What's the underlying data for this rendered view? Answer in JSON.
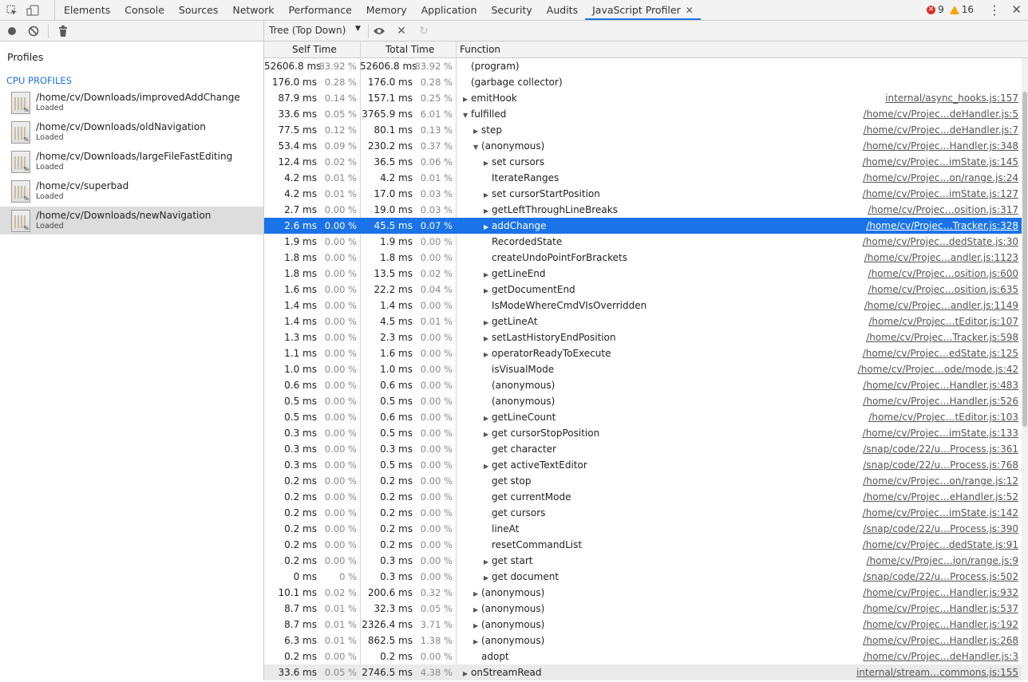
{
  "tabs": [
    {
      "label": "Elements"
    },
    {
      "label": "Console"
    },
    {
      "label": "Sources"
    },
    {
      "label": "Network"
    },
    {
      "label": "Performance"
    },
    {
      "label": "Memory"
    },
    {
      "label": "Application"
    },
    {
      "label": "Security"
    },
    {
      "label": "Audits"
    },
    {
      "label": "JavaScript Profiler",
      "active": true
    }
  ],
  "status": {
    "errors": "9",
    "warnings": "16"
  },
  "sidebar": {
    "title": "Profiles",
    "section": "CPU PROFILES",
    "profiles": [
      {
        "name": "/home/cv/Downloads/improvedAddChange",
        "status": "Loaded"
      },
      {
        "name": "/home/cv/Downloads/oldNavigation",
        "status": "Loaded"
      },
      {
        "name": "/home/cv/Downloads/largeFileFastEditing",
        "status": "Loaded"
      },
      {
        "name": "/home/cv/superbad",
        "status": "Loaded"
      },
      {
        "name": "/home/cv/Downloads/newNavigation",
        "status": "Loaded",
        "selected": true
      }
    ]
  },
  "toolbar": {
    "view": "Tree (Top Down)"
  },
  "columns": {
    "self": "Self Time",
    "total": "Total Time",
    "function": "Function"
  },
  "rows": [
    {
      "self_ms": "52606.8 ms",
      "self_pct": "83.92 %",
      "total_ms": "52606.8 ms",
      "total_pct": "83.92 %",
      "depth": 0,
      "arrow": "",
      "fn": "(program)",
      "src": ""
    },
    {
      "self_ms": "176.0 ms",
      "self_pct": "0.28 %",
      "total_ms": "176.0 ms",
      "total_pct": "0.28 %",
      "depth": 0,
      "arrow": "",
      "fn": "(garbage collector)",
      "src": ""
    },
    {
      "self_ms": "87.9 ms",
      "self_pct": "0.14 %",
      "total_ms": "157.1 ms",
      "total_pct": "0.25 %",
      "depth": 0,
      "arrow": "▶",
      "fn": "emitHook",
      "src": "internal/async_hooks.js:157"
    },
    {
      "self_ms": "33.6 ms",
      "self_pct": "0.05 %",
      "total_ms": "3765.9 ms",
      "total_pct": "6.01 %",
      "depth": 0,
      "arrow": "▼",
      "fn": "fulfilled",
      "src": "/home/cv/Projec…deHandler.js:5"
    },
    {
      "self_ms": "77.5 ms",
      "self_pct": "0.12 %",
      "total_ms": "80.1 ms",
      "total_pct": "0.13 %",
      "depth": 1,
      "arrow": "▶",
      "fn": "step",
      "src": "/home/cv/Projec…deHandler.js:7"
    },
    {
      "self_ms": "53.4 ms",
      "self_pct": "0.09 %",
      "total_ms": "230.2 ms",
      "total_pct": "0.37 %",
      "depth": 1,
      "arrow": "▼",
      "fn": "(anonymous)",
      "src": "/home/cv/Projec…Handler.js:348"
    },
    {
      "self_ms": "12.4 ms",
      "self_pct": "0.02 %",
      "total_ms": "36.5 ms",
      "total_pct": "0.06 %",
      "depth": 2,
      "arrow": "▶",
      "fn": "set cursors",
      "src": "/home/cv/Projec…imState.js:145"
    },
    {
      "self_ms": "4.2 ms",
      "self_pct": "0.01 %",
      "total_ms": "4.2 ms",
      "total_pct": "0.01 %",
      "depth": 2,
      "arrow": "",
      "fn": "IterateRanges",
      "src": "/home/cv/Projec…on/range.js:24"
    },
    {
      "self_ms": "4.2 ms",
      "self_pct": "0.01 %",
      "total_ms": "17.0 ms",
      "total_pct": "0.03 %",
      "depth": 2,
      "arrow": "▶",
      "fn": "set cursorStartPosition",
      "src": "/home/cv/Projec…imState.js:127"
    },
    {
      "self_ms": "2.7 ms",
      "self_pct": "0.00 %",
      "total_ms": "19.0 ms",
      "total_pct": "0.03 %",
      "depth": 2,
      "arrow": "▶",
      "fn": "getLeftThroughLineBreaks",
      "src": "/home/cv/Projec…osition.js:317"
    },
    {
      "self_ms": "2.6 ms",
      "self_pct": "0.00 %",
      "total_ms": "45.5 ms",
      "total_pct": "0.07 %",
      "depth": 2,
      "arrow": "▶",
      "fn": "addChange",
      "src": "/home/cv/Projec…Tracker.js:328",
      "selected": true
    },
    {
      "self_ms": "1.9 ms",
      "self_pct": "0.00 %",
      "total_ms": "1.9 ms",
      "total_pct": "0.00 %",
      "depth": 2,
      "arrow": "",
      "fn": "RecordedState",
      "src": "/home/cv/Projec…dedState.js:30"
    },
    {
      "self_ms": "1.8 ms",
      "self_pct": "0.00 %",
      "total_ms": "1.8 ms",
      "total_pct": "0.00 %",
      "depth": 2,
      "arrow": "",
      "fn": "createUndoPointForBrackets",
      "src": "/home/cv/Projec…andler.js:1123"
    },
    {
      "self_ms": "1.8 ms",
      "self_pct": "0.00 %",
      "total_ms": "13.5 ms",
      "total_pct": "0.02 %",
      "depth": 2,
      "arrow": "▶",
      "fn": "getLineEnd",
      "src": "/home/cv/Projec…osition.js:600"
    },
    {
      "self_ms": "1.6 ms",
      "self_pct": "0.00 %",
      "total_ms": "22.2 ms",
      "total_pct": "0.04 %",
      "depth": 2,
      "arrow": "▶",
      "fn": "getDocumentEnd",
      "src": "/home/cv/Projec…osition.js:635"
    },
    {
      "self_ms": "1.4 ms",
      "self_pct": "0.00 %",
      "total_ms": "1.4 ms",
      "total_pct": "0.00 %",
      "depth": 2,
      "arrow": "",
      "fn": "IsModeWhereCmdVIsOverridden",
      "src": "/home/cv/Projec…andler.js:1149"
    },
    {
      "self_ms": "1.4 ms",
      "self_pct": "0.00 %",
      "total_ms": "4.5 ms",
      "total_pct": "0.01 %",
      "depth": 2,
      "arrow": "▶",
      "fn": "getLineAt",
      "src": "/home/cv/Projec…tEditor.js:107"
    },
    {
      "self_ms": "1.3 ms",
      "self_pct": "0.00 %",
      "total_ms": "2.3 ms",
      "total_pct": "0.00 %",
      "depth": 2,
      "arrow": "▶",
      "fn": "setLastHistoryEndPosition",
      "src": "/home/cv/Projec…Tracker.js:598"
    },
    {
      "self_ms": "1.1 ms",
      "self_pct": "0.00 %",
      "total_ms": "1.6 ms",
      "total_pct": "0.00 %",
      "depth": 2,
      "arrow": "▶",
      "fn": "operatorReadyToExecute",
      "src": "/home/cv/Projec…edState.js:125"
    },
    {
      "self_ms": "1.0 ms",
      "self_pct": "0.00 %",
      "total_ms": "1.0 ms",
      "total_pct": "0.00 %",
      "depth": 2,
      "arrow": "",
      "fn": "isVisualMode",
      "src": "/home/cv/Projec…ode/mode.js:42"
    },
    {
      "self_ms": "0.6 ms",
      "self_pct": "0.00 %",
      "total_ms": "0.6 ms",
      "total_pct": "0.00 %",
      "depth": 2,
      "arrow": "",
      "fn": "(anonymous)",
      "src": "/home/cv/Projec…Handler.js:483"
    },
    {
      "self_ms": "0.5 ms",
      "self_pct": "0.00 %",
      "total_ms": "0.5 ms",
      "total_pct": "0.00 %",
      "depth": 2,
      "arrow": "",
      "fn": "(anonymous)",
      "src": "/home/cv/Projec…Handler.js:526"
    },
    {
      "self_ms": "0.5 ms",
      "self_pct": "0.00 %",
      "total_ms": "0.6 ms",
      "total_pct": "0.00 %",
      "depth": 2,
      "arrow": "▶",
      "fn": "getLineCount",
      "src": "/home/cv/Projec…tEditor.js:103"
    },
    {
      "self_ms": "0.3 ms",
      "self_pct": "0.00 %",
      "total_ms": "0.5 ms",
      "total_pct": "0.00 %",
      "depth": 2,
      "arrow": "▶",
      "fn": "get cursorStopPosition",
      "src": "/home/cv/Projec…imState.js:133"
    },
    {
      "self_ms": "0.3 ms",
      "self_pct": "0.00 %",
      "total_ms": "0.3 ms",
      "total_pct": "0.00 %",
      "depth": 2,
      "arrow": "",
      "fn": "get character",
      "src": "/snap/code/22/u…Process.js:361"
    },
    {
      "self_ms": "0.3 ms",
      "self_pct": "0.00 %",
      "total_ms": "0.5 ms",
      "total_pct": "0.00 %",
      "depth": 2,
      "arrow": "▶",
      "fn": "get activeTextEditor",
      "src": "/snap/code/22/u…Process.js:768"
    },
    {
      "self_ms": "0.2 ms",
      "self_pct": "0.00 %",
      "total_ms": "0.2 ms",
      "total_pct": "0.00 %",
      "depth": 2,
      "arrow": "",
      "fn": "get stop",
      "src": "/home/cv/Projec…on/range.js:12"
    },
    {
      "self_ms": "0.2 ms",
      "self_pct": "0.00 %",
      "total_ms": "0.2 ms",
      "total_pct": "0.00 %",
      "depth": 2,
      "arrow": "",
      "fn": "get currentMode",
      "src": "/home/cv/Projec…eHandler.js:52"
    },
    {
      "self_ms": "0.2 ms",
      "self_pct": "0.00 %",
      "total_ms": "0.2 ms",
      "total_pct": "0.00 %",
      "depth": 2,
      "arrow": "",
      "fn": "get cursors",
      "src": "/home/cv/Projec…imState.js:142"
    },
    {
      "self_ms": "0.2 ms",
      "self_pct": "0.00 %",
      "total_ms": "0.2 ms",
      "total_pct": "0.00 %",
      "depth": 2,
      "arrow": "",
      "fn": "lineAt",
      "src": "/snap/code/22/u…Process.js:390"
    },
    {
      "self_ms": "0.2 ms",
      "self_pct": "0.00 %",
      "total_ms": "0.2 ms",
      "total_pct": "0.00 %",
      "depth": 2,
      "arrow": "",
      "fn": "resetCommandList",
      "src": "/home/cv/Projec…dedState.js:91"
    },
    {
      "self_ms": "0.2 ms",
      "self_pct": "0.00 %",
      "total_ms": "0.3 ms",
      "total_pct": "0.00 %",
      "depth": 2,
      "arrow": "▶",
      "fn": "get start",
      "src": "/home/cv/Projec…ion/range.js:9"
    },
    {
      "self_ms": "0 ms",
      "self_pct": "0 %",
      "total_ms": "0.3 ms",
      "total_pct": "0.00 %",
      "depth": 2,
      "arrow": "▶",
      "fn": "get document",
      "src": "/snap/code/22/u…Process.js:502"
    },
    {
      "self_ms": "10.1 ms",
      "self_pct": "0.02 %",
      "total_ms": "200.6 ms",
      "total_pct": "0.32 %",
      "depth": 1,
      "arrow": "▶",
      "fn": "(anonymous)",
      "src": "/home/cv/Projec…Handler.js:932"
    },
    {
      "self_ms": "8.7 ms",
      "self_pct": "0.01 %",
      "total_ms": "32.3 ms",
      "total_pct": "0.05 %",
      "depth": 1,
      "arrow": "▶",
      "fn": "(anonymous)",
      "src": "/home/cv/Projec…Handler.js:537"
    },
    {
      "self_ms": "8.7 ms",
      "self_pct": "0.01 %",
      "total_ms": "2326.4 ms",
      "total_pct": "3.71 %",
      "depth": 1,
      "arrow": "▶",
      "fn": "(anonymous)",
      "src": "/home/cv/Projec…Handler.js:192"
    },
    {
      "self_ms": "6.3 ms",
      "self_pct": "0.01 %",
      "total_ms": "862.5 ms",
      "total_pct": "1.38 %",
      "depth": 1,
      "arrow": "▶",
      "fn": "(anonymous)",
      "src": "/home/cv/Projec…Handler.js:268"
    },
    {
      "self_ms": "0.2 ms",
      "self_pct": "0.00 %",
      "total_ms": "0.2 ms",
      "total_pct": "0.00 %",
      "depth": 1,
      "arrow": "",
      "fn": "adopt",
      "src": "/home/cv/Projec…deHandler.js:3"
    },
    {
      "self_ms": "33.6 ms",
      "self_pct": "0.05 %",
      "total_ms": "2746.5 ms",
      "total_pct": "4.38 %",
      "depth": 0,
      "arrow": "▶",
      "fn": "onStreamRead",
      "src": "internal/stream…commons.js:155",
      "alt": true
    }
  ]
}
